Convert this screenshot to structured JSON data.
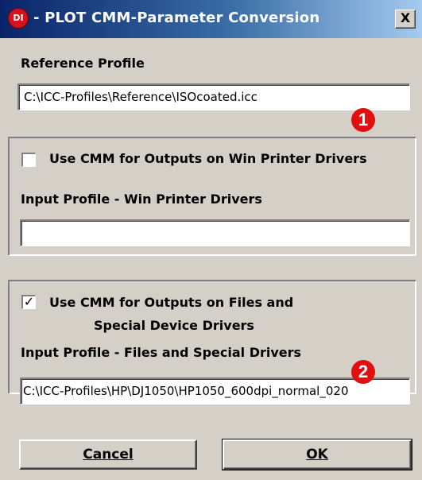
{
  "window": {
    "title": "- PLOT  CMM-Parameter Conversion",
    "app_icon": "DI",
    "close": "X"
  },
  "reference": {
    "label": "Reference Profile",
    "value": "C:\\ICC-Profiles\\Reference\\ISOcoated.icc",
    "badge": "1"
  },
  "win_printer": {
    "checkbox_label": "Use CMM for Outputs on Win Printer Drivers",
    "checked": false,
    "input_label": "Input Profile - Win Printer Drivers",
    "value": ""
  },
  "files": {
    "checkbox_label_line1": "Use CMM for Outputs on Files and",
    "checkbox_label_line2": "Special Device Drivers",
    "checked": true,
    "check_mark": "✓",
    "input_label": "Input Profile - Files and Special Drivers",
    "value": "C:\\ICC-Profiles\\HP\\DJ1050\\HP1050_600dpi_normal_020",
    "badge": "2"
  },
  "buttons": {
    "cancel": "Cancel",
    "ok": "OK"
  }
}
